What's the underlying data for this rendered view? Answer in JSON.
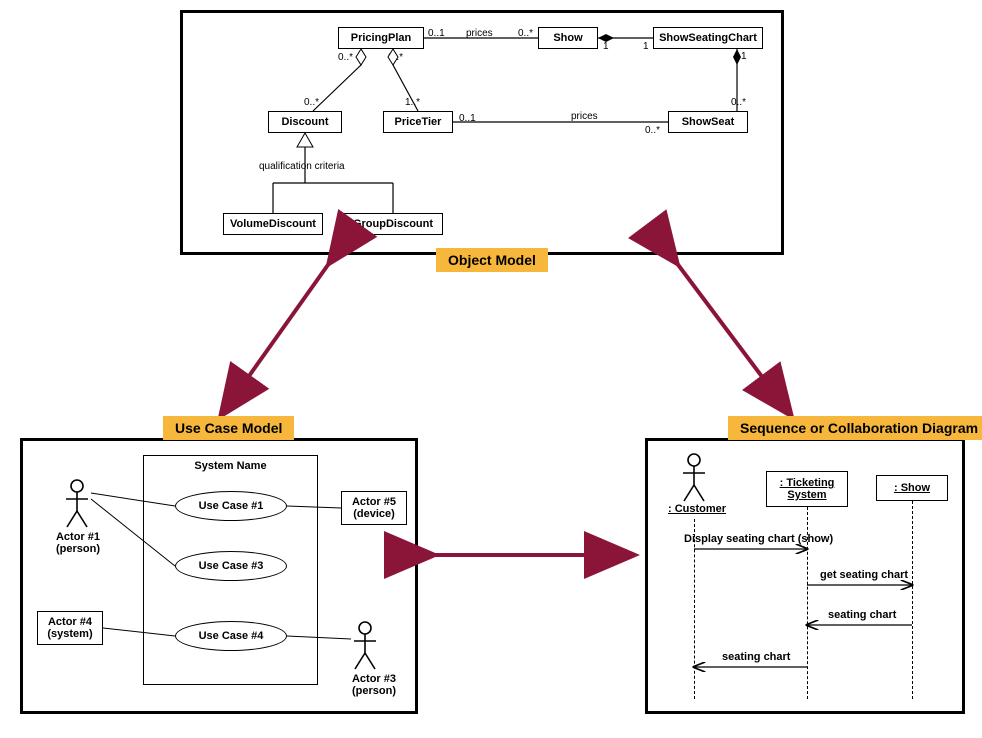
{
  "labels": {
    "objectModel": "Object Model",
    "useCaseModel": "Use Case Model",
    "seqDiagram": "Sequence or Collaboration Diagram"
  },
  "classPanel": {
    "classes": {
      "PricingPlan": "PricingPlan",
      "Show": "Show",
      "ShowSeatingChart": "ShowSeatingChart",
      "Discount": "Discount",
      "PriceTier": "PriceTier",
      "ShowSeat": "ShowSeat",
      "VolumeDiscount": "VolumeDiscount",
      "GroupDiscount": "GroupDiscount"
    },
    "annotations": {
      "pricesTop": "prices",
      "pricesBottom": "prices",
      "qualCriteria": "qualification criteria",
      "m_0s": "0..*",
      "m_01": "0..1",
      "m_1s": "1..*",
      "m_1": "1"
    }
  },
  "useCase": {
    "system": "System Name",
    "uc1": "Use Case #1",
    "uc3": "Use Case #3",
    "uc4": "Use Case #4",
    "actor1": {
      "line1": "Actor #1",
      "line2": "(person)"
    },
    "actor3": {
      "line1": "Actor #3",
      "line2": "(person)"
    },
    "actor4": {
      "line1": "Actor #4",
      "line2": "(system)"
    },
    "actor5": {
      "line1": "Actor #5",
      "line2": "(device)"
    }
  },
  "seq": {
    "customer": ": Customer",
    "ticketing": ": Ticketing System",
    "show": ": Show",
    "msg1": "Display seating chart (show)",
    "msg2": "get seating chart",
    "msg3": "seating chart",
    "msg4": "seating chart"
  }
}
